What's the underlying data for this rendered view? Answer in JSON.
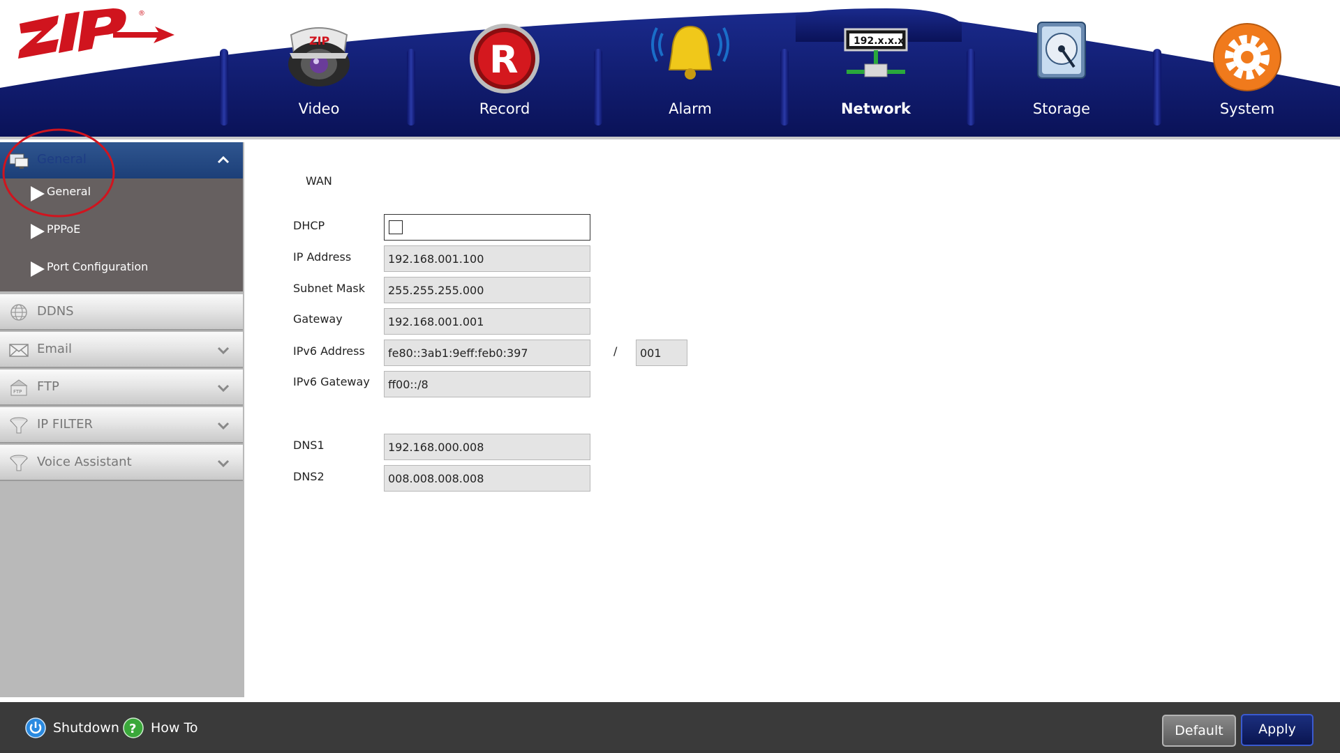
{
  "header": {
    "logo_text": "ZIP",
    "nav": [
      {
        "label": "Video",
        "icon": "dome-camera-icon"
      },
      {
        "label": "Record",
        "icon": "record-icon"
      },
      {
        "label": "Alarm",
        "icon": "bell-icon"
      },
      {
        "label": "Network",
        "icon": "network-icon",
        "active": true,
        "icon_text": "192.x.x.x"
      },
      {
        "label": "Storage",
        "icon": "hard-disk-icon"
      },
      {
        "label": "System",
        "icon": "gear-icon"
      }
    ]
  },
  "sidebar": {
    "groups": [
      {
        "label": "General",
        "icon": "network-adapter-icon",
        "expanded": true,
        "items": [
          {
            "label": "General",
            "selected": true
          },
          {
            "label": "PPPoE"
          },
          {
            "label": "Port Configuration"
          }
        ]
      },
      {
        "label": "DDNS",
        "icon": "globe-icon"
      },
      {
        "label": "Email",
        "icon": "envelope-icon"
      },
      {
        "label": "FTP",
        "icon": "ftp-icon"
      },
      {
        "label": "IP FILTER",
        "icon": "funnel-icon"
      },
      {
        "label": "Voice Assistant",
        "icon": "funnel-icon"
      }
    ]
  },
  "main": {
    "section_title": "WAN",
    "fields": {
      "dhcp": {
        "label": "DHCP",
        "checked": false
      },
      "ip_address": {
        "label": "IP Address",
        "value": "192.168.001.100"
      },
      "subnet_mask": {
        "label": "Subnet Mask",
        "value": "255.255.255.000"
      },
      "gateway": {
        "label": "Gateway",
        "value": "192.168.001.001"
      },
      "ipv6_address": {
        "label": "IPv6 Address",
        "value": "fe80::3ab1:9eff:feb0:397",
        "separator": "/",
        "prefix": "001"
      },
      "ipv6_gateway": {
        "label": "IPv6 Gateway",
        "value": "ff00::/8"
      },
      "dns1": {
        "label": "DNS1",
        "value": "192.168.000.008"
      },
      "dns2": {
        "label": "DNS2",
        "value": "008.008.008.008"
      }
    }
  },
  "footer": {
    "shutdown_label": "Shutdown",
    "howto_label": "How To",
    "default_label": "Default",
    "apply_label": "Apply"
  },
  "colors": {
    "header_navy": "#0f1a6e",
    "sidebar_active": "#274a88",
    "annotation_red": "#d0141e"
  }
}
